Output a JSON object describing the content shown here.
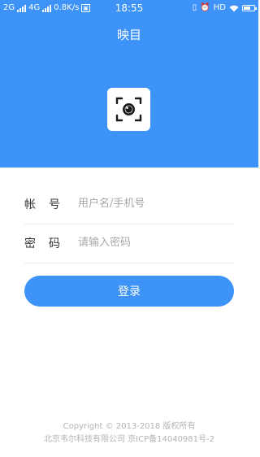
{
  "status_bar": {
    "network_1": "2G",
    "network_2": "4G",
    "speed": "0.8K/s",
    "time": "18:55",
    "hd": "HD"
  },
  "header": {
    "title": "映目"
  },
  "login_form": {
    "account_label": "帐号",
    "account_placeholder": "用户名/手机号",
    "password_label": "密码",
    "password_placeholder": "请输入密码",
    "login_button": "登录"
  },
  "footer": {
    "copyright": "Copyright © 2013-2018 版权所有",
    "company": "北京韦尔科技有限公司 京ICP备14040981号-2"
  },
  "colors": {
    "primary": "#3d93f7",
    "placeholder": "#a7a7a7",
    "footer_text": "#b3b3b3"
  }
}
